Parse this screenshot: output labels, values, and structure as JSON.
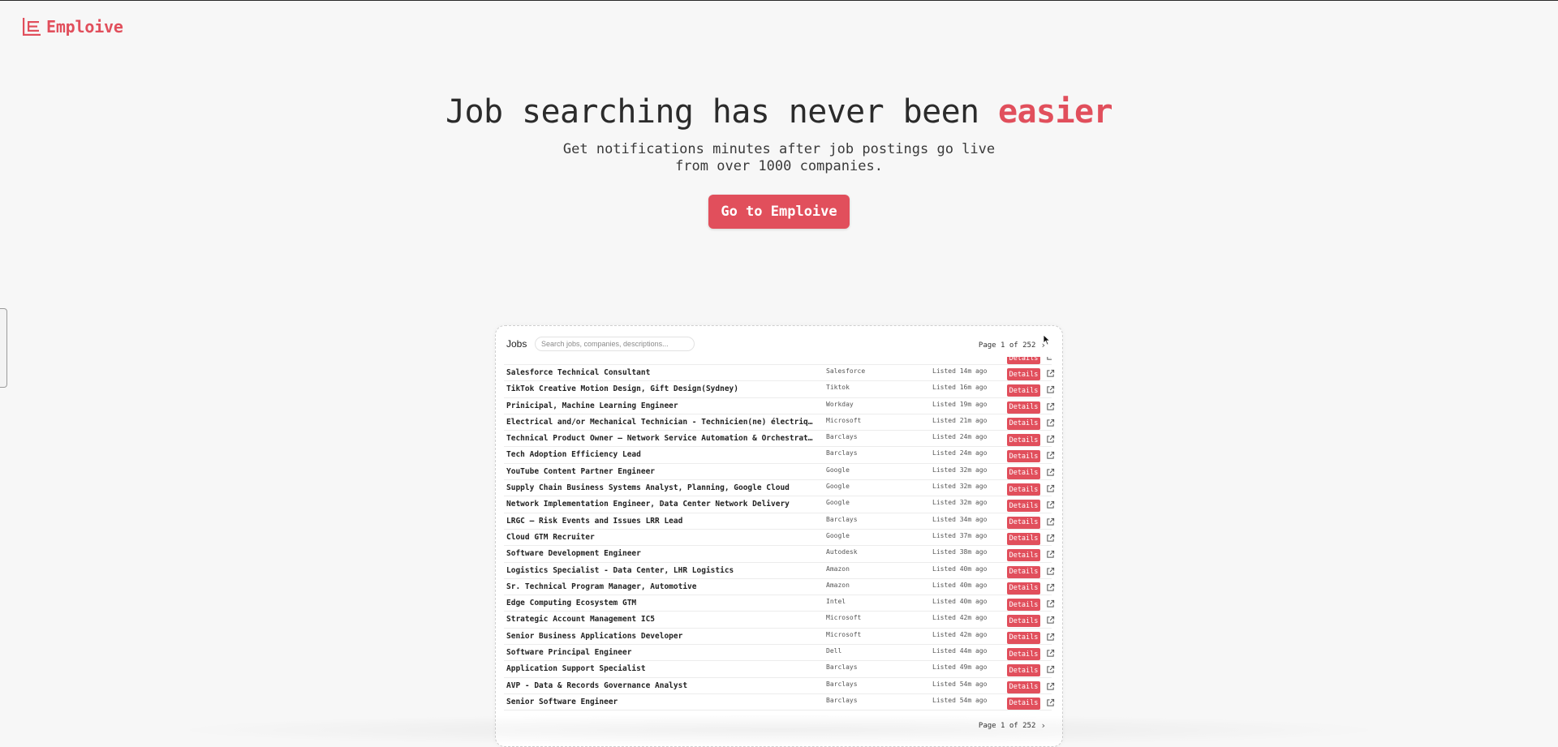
{
  "brand": {
    "name": "Emploive",
    "color": "#e14f5c"
  },
  "hero": {
    "title_main": "Job searching has never been ",
    "title_accent": "easier",
    "subtitle": "Get notifications minutes after job postings go live from over 1000 companies.",
    "cta_label": "Go to Emploive"
  },
  "jobs_panel": {
    "title": "Jobs",
    "search_placeholder": "Search jobs, companies, descriptions...",
    "pager_top": "Page 1 of 252",
    "pager_bottom": "Page 1 of 252",
    "details_label": "Details",
    "rows": [
      {
        "title": "Salesforce Technical Consultant",
        "company": "Salesforce",
        "time": "Listed 14m ago"
      },
      {
        "title": "TikTok Creative Motion Design, Gift Design(Sydney)",
        "company": "Tiktok",
        "time": "Listed 16m ago"
      },
      {
        "title": "Prinicipal, Machine Learning Engineer",
        "company": "Workday",
        "time": "Listed 19m ago"
      },
      {
        "title": "Electrical and/or Mechanical Technician - Technicien(ne) électrique …",
        "company": "Microsoft",
        "time": "Listed 21m ago"
      },
      {
        "title": "Technical Product Owner – Network Service Automation & Orchestration",
        "company": "Barclays",
        "time": "Listed 24m ago"
      },
      {
        "title": "Tech Adoption Efficiency Lead",
        "company": "Barclays",
        "time": "Listed 24m ago"
      },
      {
        "title": "YouTube Content Partner Engineer",
        "company": "Google",
        "time": "Listed 32m ago"
      },
      {
        "title": "Supply Chain Business Systems Analyst, Planning, Google Cloud",
        "company": "Google",
        "time": "Listed 32m ago"
      },
      {
        "title": "Network Implementation Engineer, Data Center Network Delivery",
        "company": "Google",
        "time": "Listed 32m ago"
      },
      {
        "title": "LRGC – Risk Events and Issues LRR Lead",
        "company": "Barclays",
        "time": "Listed 34m ago"
      },
      {
        "title": "Cloud GTM Recruiter",
        "company": "Google",
        "time": "Listed 37m ago"
      },
      {
        "title": "Software Development Engineer",
        "company": "Autodesk",
        "time": "Listed 38m ago"
      },
      {
        "title": "Logistics Specialist - Data Center, LHR Logistics",
        "company": "Amazon",
        "time": "Listed 40m ago"
      },
      {
        "title": "Sr. Technical Program Manager, Automotive",
        "company": "Amazon",
        "time": "Listed 40m ago"
      },
      {
        "title": "Edge Computing Ecosystem GTM",
        "company": "Intel",
        "time": "Listed 40m ago"
      },
      {
        "title": "Strategic Account Management IC5",
        "company": "Microsoft",
        "time": "Listed 42m ago"
      },
      {
        "title": "Senior Business Applications Developer",
        "company": "Microsoft",
        "time": "Listed 42m ago"
      },
      {
        "title": "Software Principal Engineer",
        "company": "Dell",
        "time": "Listed 44m ago"
      },
      {
        "title": "Application Support Specialist",
        "company": "Barclays",
        "time": "Listed 49m ago"
      },
      {
        "title": "AVP - Data & Records Governance Analyst",
        "company": "Barclays",
        "time": "Listed 54m ago"
      },
      {
        "title": "Senior Software Engineer",
        "company": "Barclays",
        "time": "Listed 54m ago"
      }
    ]
  }
}
